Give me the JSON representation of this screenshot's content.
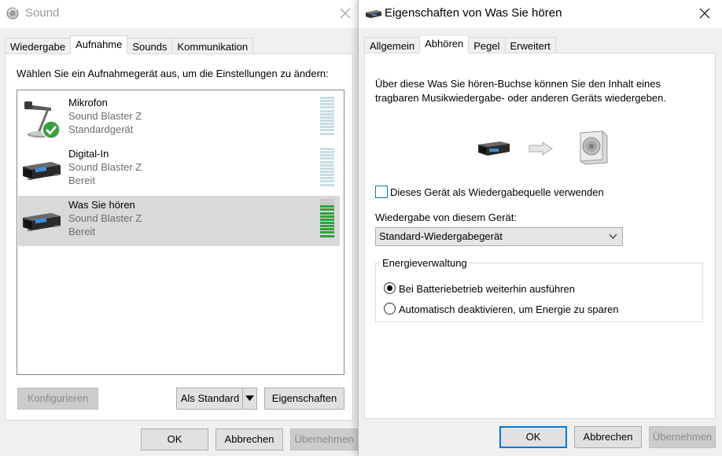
{
  "sound_window": {
    "title": "Sound",
    "tabs": [
      "Wiedergabe",
      "Aufnahme",
      "Sounds",
      "Kommunikation"
    ],
    "active_tab": "Aufnahme",
    "instruction": "Wählen Sie ein Aufnahmegerät aus, um die Einstellungen zu ändern:",
    "devices": [
      {
        "name": "Mikrofon",
        "driver": "Sound Blaster Z",
        "status": "Standardgerät",
        "icon": "microphone-icon",
        "default": true,
        "selected": false,
        "level": 0
      },
      {
        "name": "Digital-In",
        "driver": "Sound Blaster Z",
        "status": "Bereit",
        "icon": "sound-card-icon",
        "default": false,
        "selected": false,
        "level": 0
      },
      {
        "name": "Was Sie hören",
        "driver": "Sound Blaster Z",
        "status": "Bereit",
        "icon": "sound-card-icon",
        "default": false,
        "selected": true,
        "level": 0.8
      }
    ],
    "buttons": {
      "configure": "Konfigurieren",
      "set_default": "Als Standard",
      "properties": "Eigenschaften",
      "ok": "OK",
      "cancel": "Abbrechen",
      "apply": "Übernehmen"
    }
  },
  "properties_window": {
    "title": "Eigenschaften von Was Sie hören",
    "tabs": [
      "Allgemein",
      "Abhören",
      "Pegel",
      "Erweitert"
    ],
    "active_tab": "Abhören",
    "description_line1": "Über diese Was Sie hören-Buchse können Sie den Inhalt eines",
    "description_line2": "tragbaren Musikwiedergabe- oder anderen Geräts wiedergeben.",
    "listen_checkbox_label": "Dieses Gerät als Wiedergabequelle verwenden",
    "listen_checked": false,
    "playback_label": "Wiedergabe von diesem Gerät:",
    "playback_selected": "Standard-Wiedergabegerät",
    "power_group_label": "Energieverwaltung",
    "power_options": [
      {
        "label": "Bei Batteriebetrieb weiterhin ausführen",
        "selected": true
      },
      {
        "label": "Automatisch deaktivieren, um Energie zu sparen",
        "selected": false
      }
    ],
    "buttons": {
      "ok": "OK",
      "cancel": "Abbrechen",
      "apply": "Übernehmen"
    }
  },
  "colors": {
    "accent": "#0078d7",
    "meter_active": "#2ea33a",
    "meter_idle": "#c6dde6",
    "selection": "#d9d9d9"
  }
}
